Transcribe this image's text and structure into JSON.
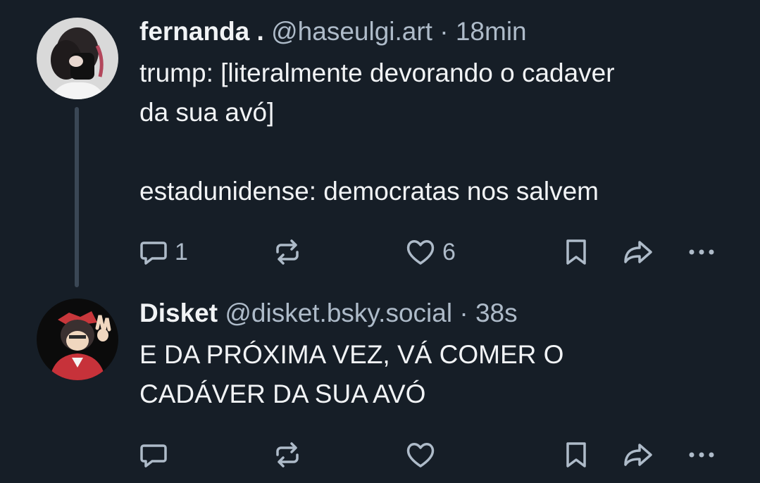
{
  "posts": [
    {
      "display_name": "fernanda .",
      "handle": "@haseulgi.art",
      "separator": "·",
      "time": "18min",
      "text_line1": "trump: [literalmente devorando o cadaver",
      "text_line2": "da sua avó]",
      "text_line3": "estadunidense: democratas nos salvem",
      "reply_count": "1",
      "like_count": "6"
    },
    {
      "display_name": "Disket",
      "handle": "@disket.bsky.social",
      "separator": "·",
      "time": "38s",
      "text_line1": "E DA PRÓXIMA VEZ, VÁ COMER O",
      "text_line2": "CADÁVER DA SUA AVÓ",
      "reply_count": "",
      "like_count": ""
    }
  ],
  "icons": [
    "reply-icon",
    "repost-icon",
    "like-icon",
    "bookmark-icon",
    "share-icon",
    "more-icon"
  ],
  "colors": {
    "background": "#161e27",
    "text": "#f1f3f5",
    "muted": "#aebbc9",
    "thread_line": "#3a4755"
  }
}
